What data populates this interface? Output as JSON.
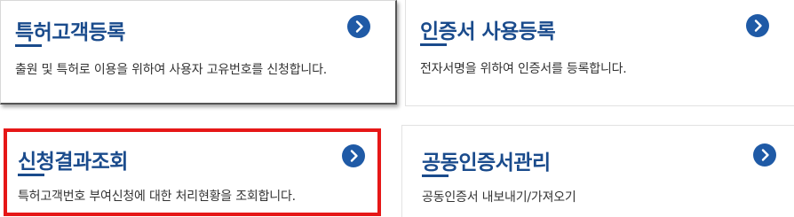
{
  "colors": {
    "title": "#1a4b8c",
    "arrow_button": "#1f5aa6",
    "highlight_border": "#e61717",
    "description": "#333333"
  },
  "cards": [
    {
      "title": "특허고객등록",
      "description": "출원 및 특허로 이용을 위하여 사용자 고유번호를 신청합니다.",
      "icon": "chevron-right-circle-icon"
    },
    {
      "title": "인증서 사용등록",
      "description": "전자서명을 위하여 인증서를 등록합니다.",
      "icon": "chevron-right-circle-icon"
    },
    {
      "title": "신청결과조회",
      "description": "특허고객번호 부여신청에 대한 처리현황을 조회합니다.",
      "icon": "chevron-right-circle-icon"
    },
    {
      "title": "공동인증서관리",
      "description": "공동인증서 내보내기/가져오기",
      "icon": "chevron-right-circle-icon"
    }
  ]
}
